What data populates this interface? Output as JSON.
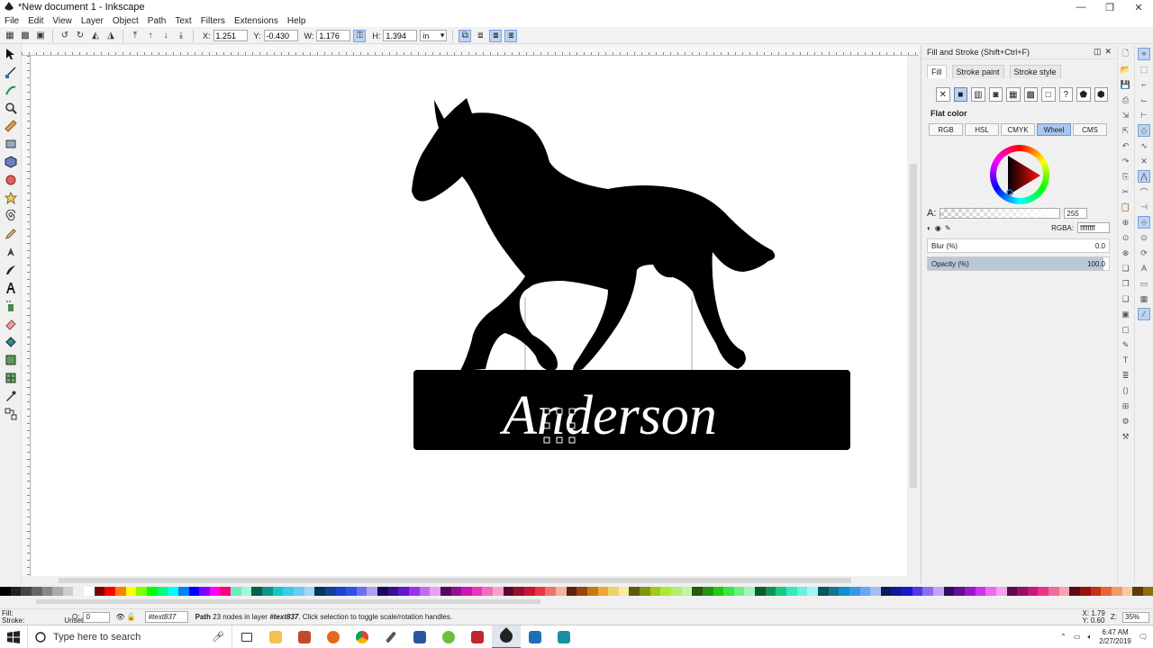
{
  "window": {
    "title": "*New document 1 - Inkscape",
    "minimize": "—",
    "maximize": "❐",
    "close": "✕"
  },
  "menu": [
    "File",
    "Edit",
    "View",
    "Layer",
    "Object",
    "Path",
    "Text",
    "Filters",
    "Extensions",
    "Help"
  ],
  "controls": {
    "x_label": "X:",
    "x_value": "1.251",
    "y_label": "Y:",
    "y_value": "-0.430",
    "w_label": "W:",
    "w_value": "1.176",
    "h_label": "H:",
    "h_value": "1.394",
    "unit": "in"
  },
  "canvas": {
    "name_text": "Anderson"
  },
  "panel": {
    "title": "Fill and Stroke (Shift+Ctrl+F)",
    "tabs": [
      "Fill",
      "Stroke paint",
      "Stroke style"
    ],
    "flat_color": "Flat color",
    "modes": [
      "RGB",
      "HSL",
      "CMYK",
      "Wheel",
      "CMS"
    ],
    "active_mode": "Wheel",
    "alpha_label": "A:",
    "alpha_value": "255",
    "rgba_label": "RGBA:",
    "rgba_value": "ffffffff",
    "blur_label": "Blur (%)",
    "blur_value": "0.0",
    "opacity_label": "Opacity (%)",
    "opacity_value": "100.0"
  },
  "status": {
    "fill_label": "Fill:",
    "stroke_label": "Stroke:",
    "stroke_value": "Unset",
    "opacity_prefix": "O:",
    "opacity_value": "0",
    "layer": "#text837",
    "message_bold": "Path",
    "message": "23 nodes in layer ",
    "message_layer": "#text837",
    "message_tail": ". Click selection to toggle scale/rotation handles.",
    "x_label": "X:",
    "x_value": "1.79",
    "y_label": "Y:",
    "y_value": "0.60",
    "zoom_label": "Z:",
    "zoom_value": "35%"
  },
  "taskbar": {
    "search_placeholder": "Type here to search",
    "time": "6:47 AM",
    "date": "2/27/2019"
  },
  "colors": {
    "accent": "#2a6fc9",
    "selection_blue": "#bcd3f0",
    "shape_fill": "#000000",
    "text_fill": "#ffffff"
  }
}
